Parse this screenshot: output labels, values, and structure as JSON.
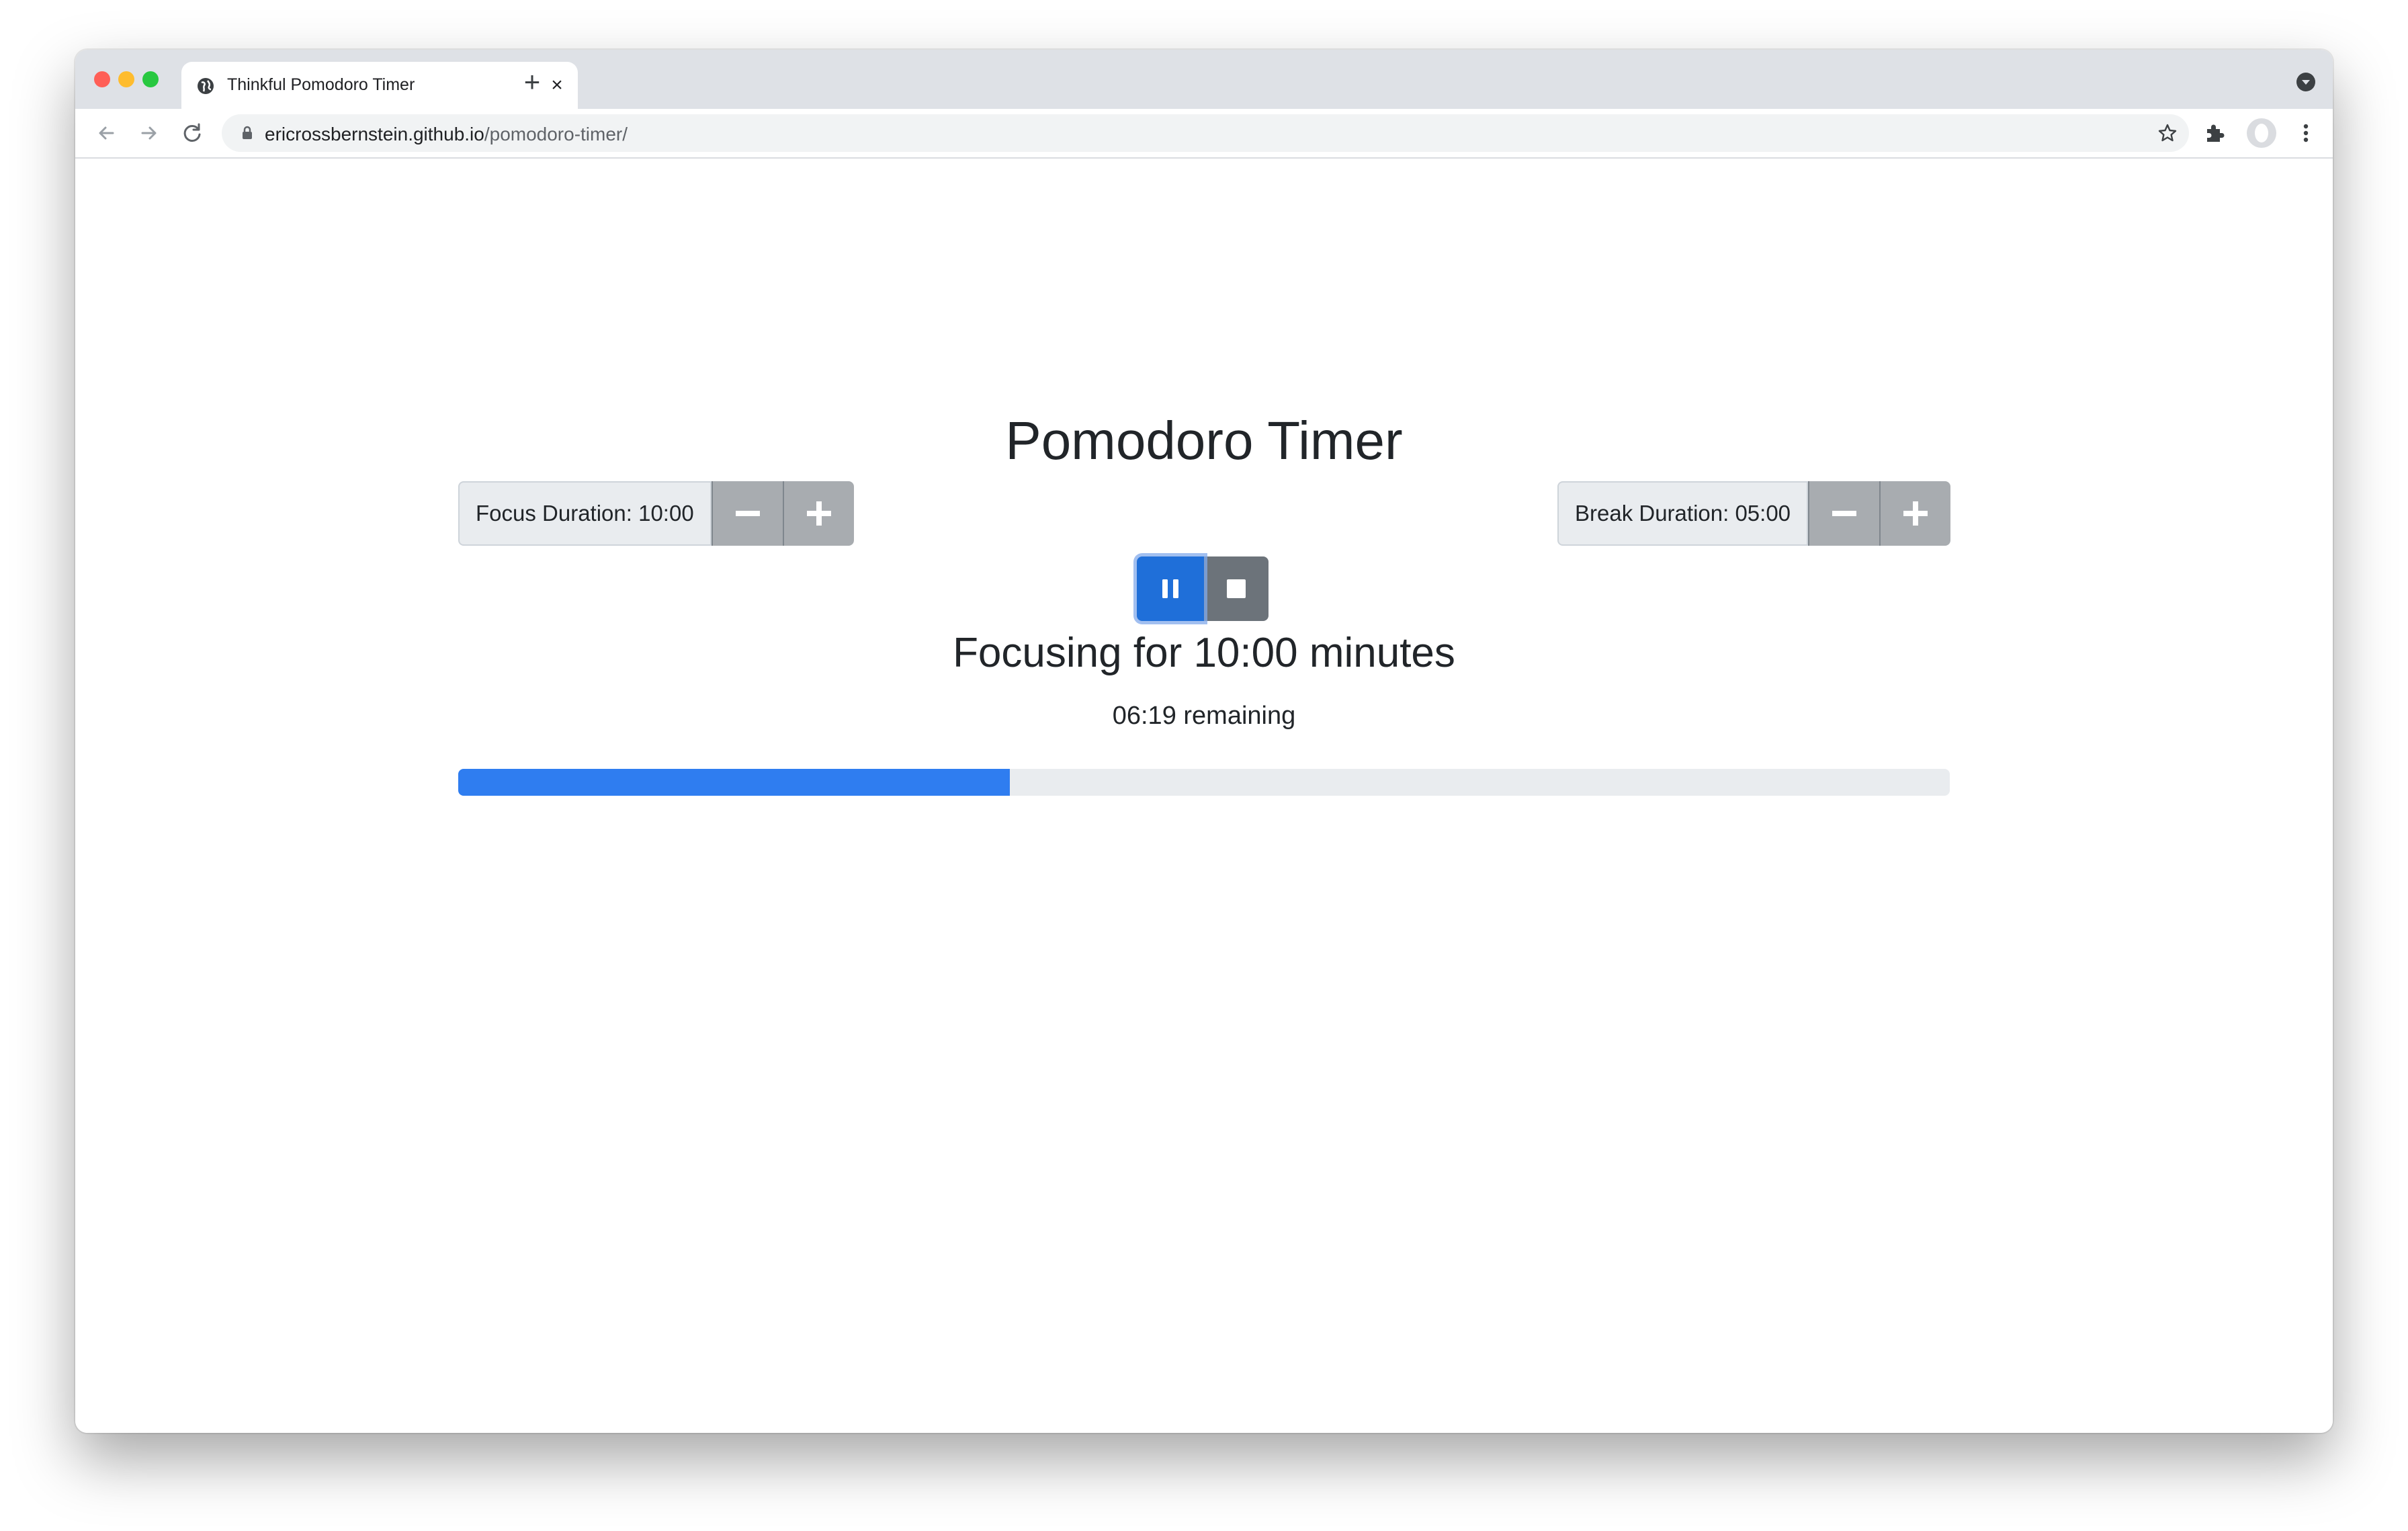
{
  "browser": {
    "tab_title": "Thinkful Pomodoro Timer",
    "tab_close": "×",
    "new_tab": "+",
    "url_host": "ericrossbernstein.github.io",
    "url_path": "/pomodoro-timer/",
    "icons": [
      "globe-icon",
      "back-icon",
      "forward-icon",
      "reload-icon",
      "lock-icon",
      "star-icon",
      "extensions-icon",
      "avatar-icon",
      "more-icon"
    ]
  },
  "app": {
    "title": "Pomodoro Timer",
    "focus": {
      "label": "Focus Duration: 10:00"
    },
    "break": {
      "label": "Break Duration: 05:00"
    },
    "status_heading": "Focusing for 10:00 minutes",
    "remaining": "06:19 remaining",
    "progress_fraction": 0.37,
    "colors": {
      "primary": "#1f6fd9",
      "progress": "#2f7df0",
      "secondary": "#6c737a",
      "stepper": "#a8acb0"
    }
  }
}
